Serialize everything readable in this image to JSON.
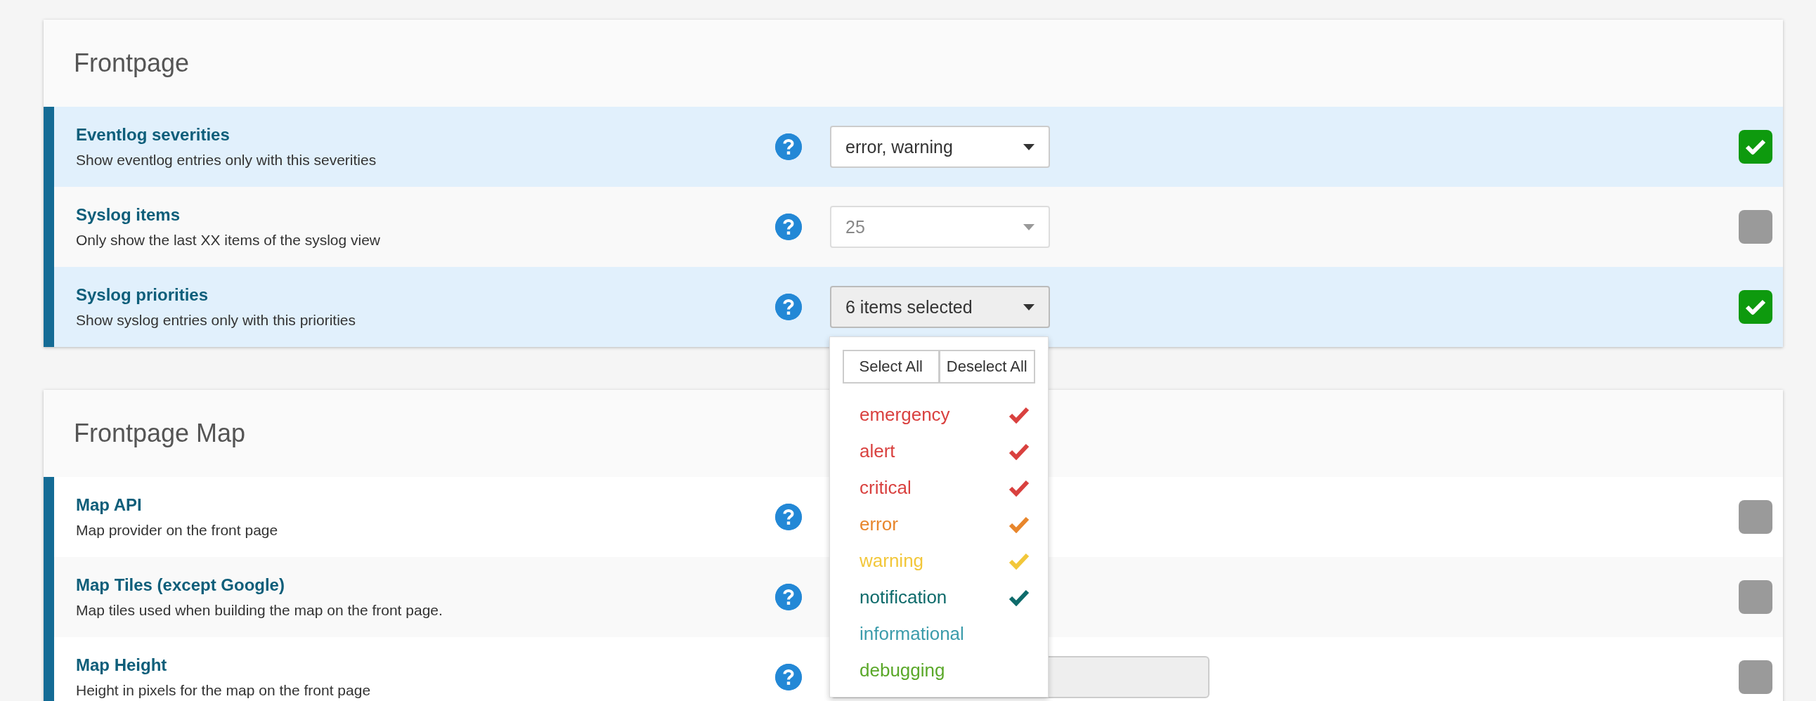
{
  "sections": [
    {
      "title": "Frontpage",
      "settings": [
        {
          "title": "Eventlog severities",
          "description": "Show eventlog entries only with this severities",
          "control": {
            "kind": "select",
            "value": "error, warning",
            "disabled": false,
            "open": false
          },
          "checked": true
        },
        {
          "title": "Syslog items",
          "description": "Only show the last XX items of the syslog view",
          "control": {
            "kind": "select",
            "value": "25",
            "disabled": true,
            "open": false
          },
          "checked": false
        },
        {
          "title": "Syslog priorities",
          "description": "Show syslog entries only with this priorities",
          "control": {
            "kind": "select",
            "value": "6 items selected",
            "disabled": false,
            "open": true,
            "dropdown": {
              "actions": [
                "Select All",
                "Deselect All"
              ],
              "options": [
                {
                  "label": "emergency",
                  "color": "#d9413f",
                  "selected": true
                },
                {
                  "label": "alert",
                  "color": "#d9413f",
                  "selected": true
                },
                {
                  "label": "critical",
                  "color": "#d9413f",
                  "selected": true
                },
                {
                  "label": "error",
                  "color": "#e8862c",
                  "selected": true
                },
                {
                  "label": "warning",
                  "color": "#f2c73a",
                  "selected": true
                },
                {
                  "label": "notification",
                  "color": "#0e6b6b",
                  "selected": true
                },
                {
                  "label": "informational",
                  "color": "#3c9cab",
                  "selected": false
                },
                {
                  "label": "debugging",
                  "color": "#5aa829",
                  "selected": false
                }
              ]
            }
          },
          "checked": true
        }
      ]
    },
    {
      "title": "Frontpage Map",
      "settings": [
        {
          "title": "Map API",
          "description": "Map provider on the front page",
          "control": {
            "kind": "none"
          },
          "checked": false
        },
        {
          "title": "Map Tiles (except Google)",
          "description": "Map tiles used when building the map on the front page.",
          "control": {
            "kind": "none"
          },
          "checked": false
        },
        {
          "title": "Map Height",
          "description": "Height in pixels for the map on the front page",
          "control": {
            "kind": "text"
          },
          "checked": false
        }
      ]
    }
  ]
}
